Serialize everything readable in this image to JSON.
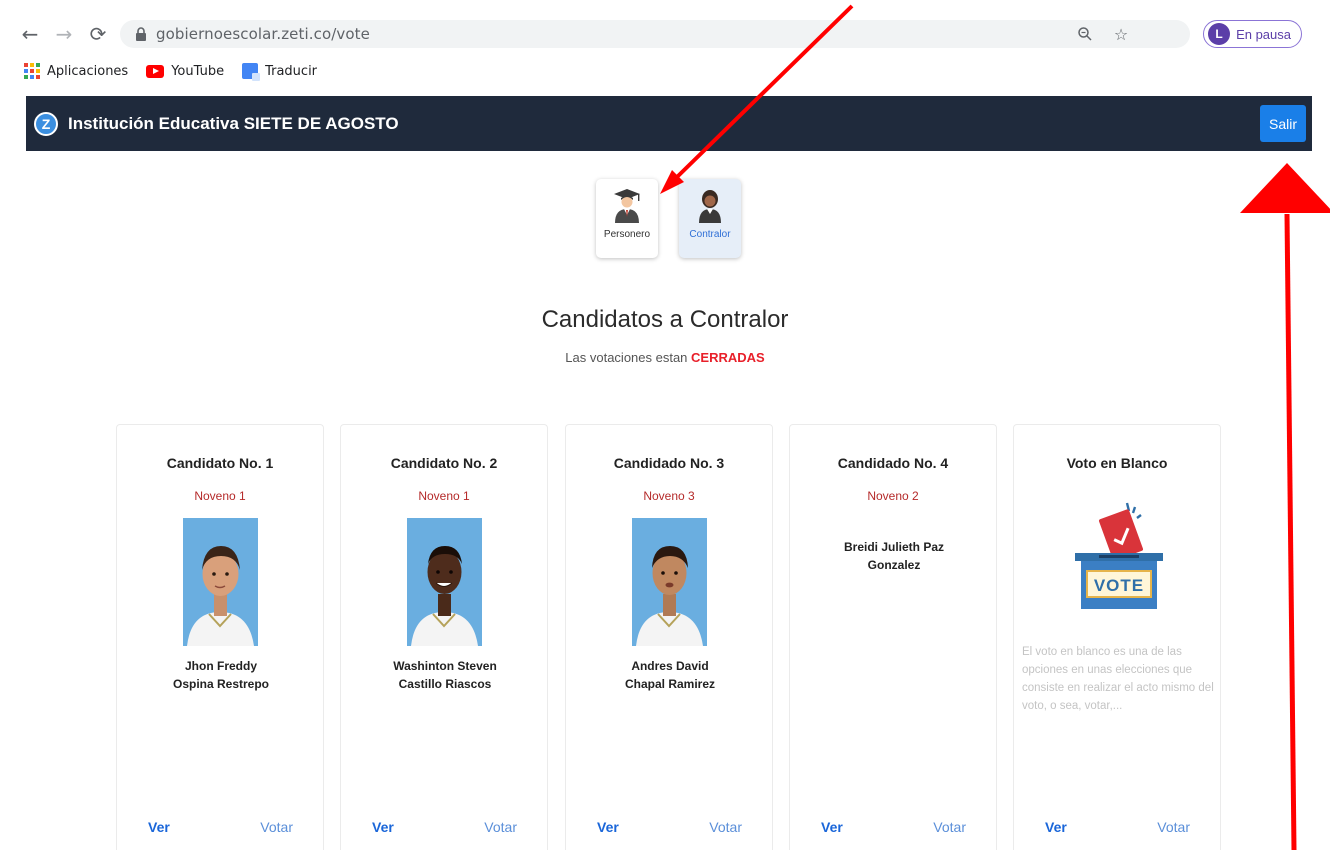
{
  "browser": {
    "url": "gobiernoescolar.zeti.co/vote",
    "profile_initial": "L",
    "profile_status": "En pausa",
    "bookmarks": [
      {
        "label": "Aplicaciones",
        "icon": "apps-grid-icon"
      },
      {
        "label": "YouTube",
        "icon": "youtube-icon"
      },
      {
        "label": "Traducir",
        "icon": "translate-icon"
      }
    ]
  },
  "header": {
    "logo_letter": "Z",
    "institution": "Institución Educativa SIETE DE AGOSTO",
    "logout_label": "Salir"
  },
  "roles": [
    {
      "label": "Personero",
      "icon": "graduate-icon"
    },
    {
      "label": "Contralor",
      "icon": "student-icon"
    }
  ],
  "section": {
    "title": "Candidatos a Contralor",
    "status_prefix": "Las votaciones estan",
    "status_value": "CERRADAS"
  },
  "candidates": [
    {
      "title": "Candidato No. 1",
      "grade": "Noveno 1",
      "name_line1": "Jhon Freddy",
      "name_line2": "Ospina Restrepo"
    },
    {
      "title": "Candidato No. 2",
      "grade": "Noveno 1",
      "name_line1": "Washinton Steven",
      "name_line2": "Castillo Riascos"
    },
    {
      "title": "Candidado No. 3",
      "grade": "Noveno 3",
      "name_line1": "Andres David",
      "name_line2": "Chapal Ramirez"
    },
    {
      "title": "Candidado No. 4",
      "grade": "Noveno 2",
      "name_line1": "Breidi Julieth Paz",
      "name_line2": "Gonzalez"
    }
  ],
  "blank_vote": {
    "title": "Voto en Blanco",
    "box_text": "VOTE",
    "description": "El voto en blanco es una de las opciones en unas elecciones que consiste en realizar el acto mismo del voto, o sea, votar,..."
  },
  "actions": {
    "view_label": "Ver",
    "vote_label": "Votar"
  },
  "colors": {
    "header_bg": "#1f2a3c",
    "primary": "#1a7fe8",
    "closed": "#e8202a",
    "grade": "#b52a2a",
    "annotation": "#ff0000"
  }
}
